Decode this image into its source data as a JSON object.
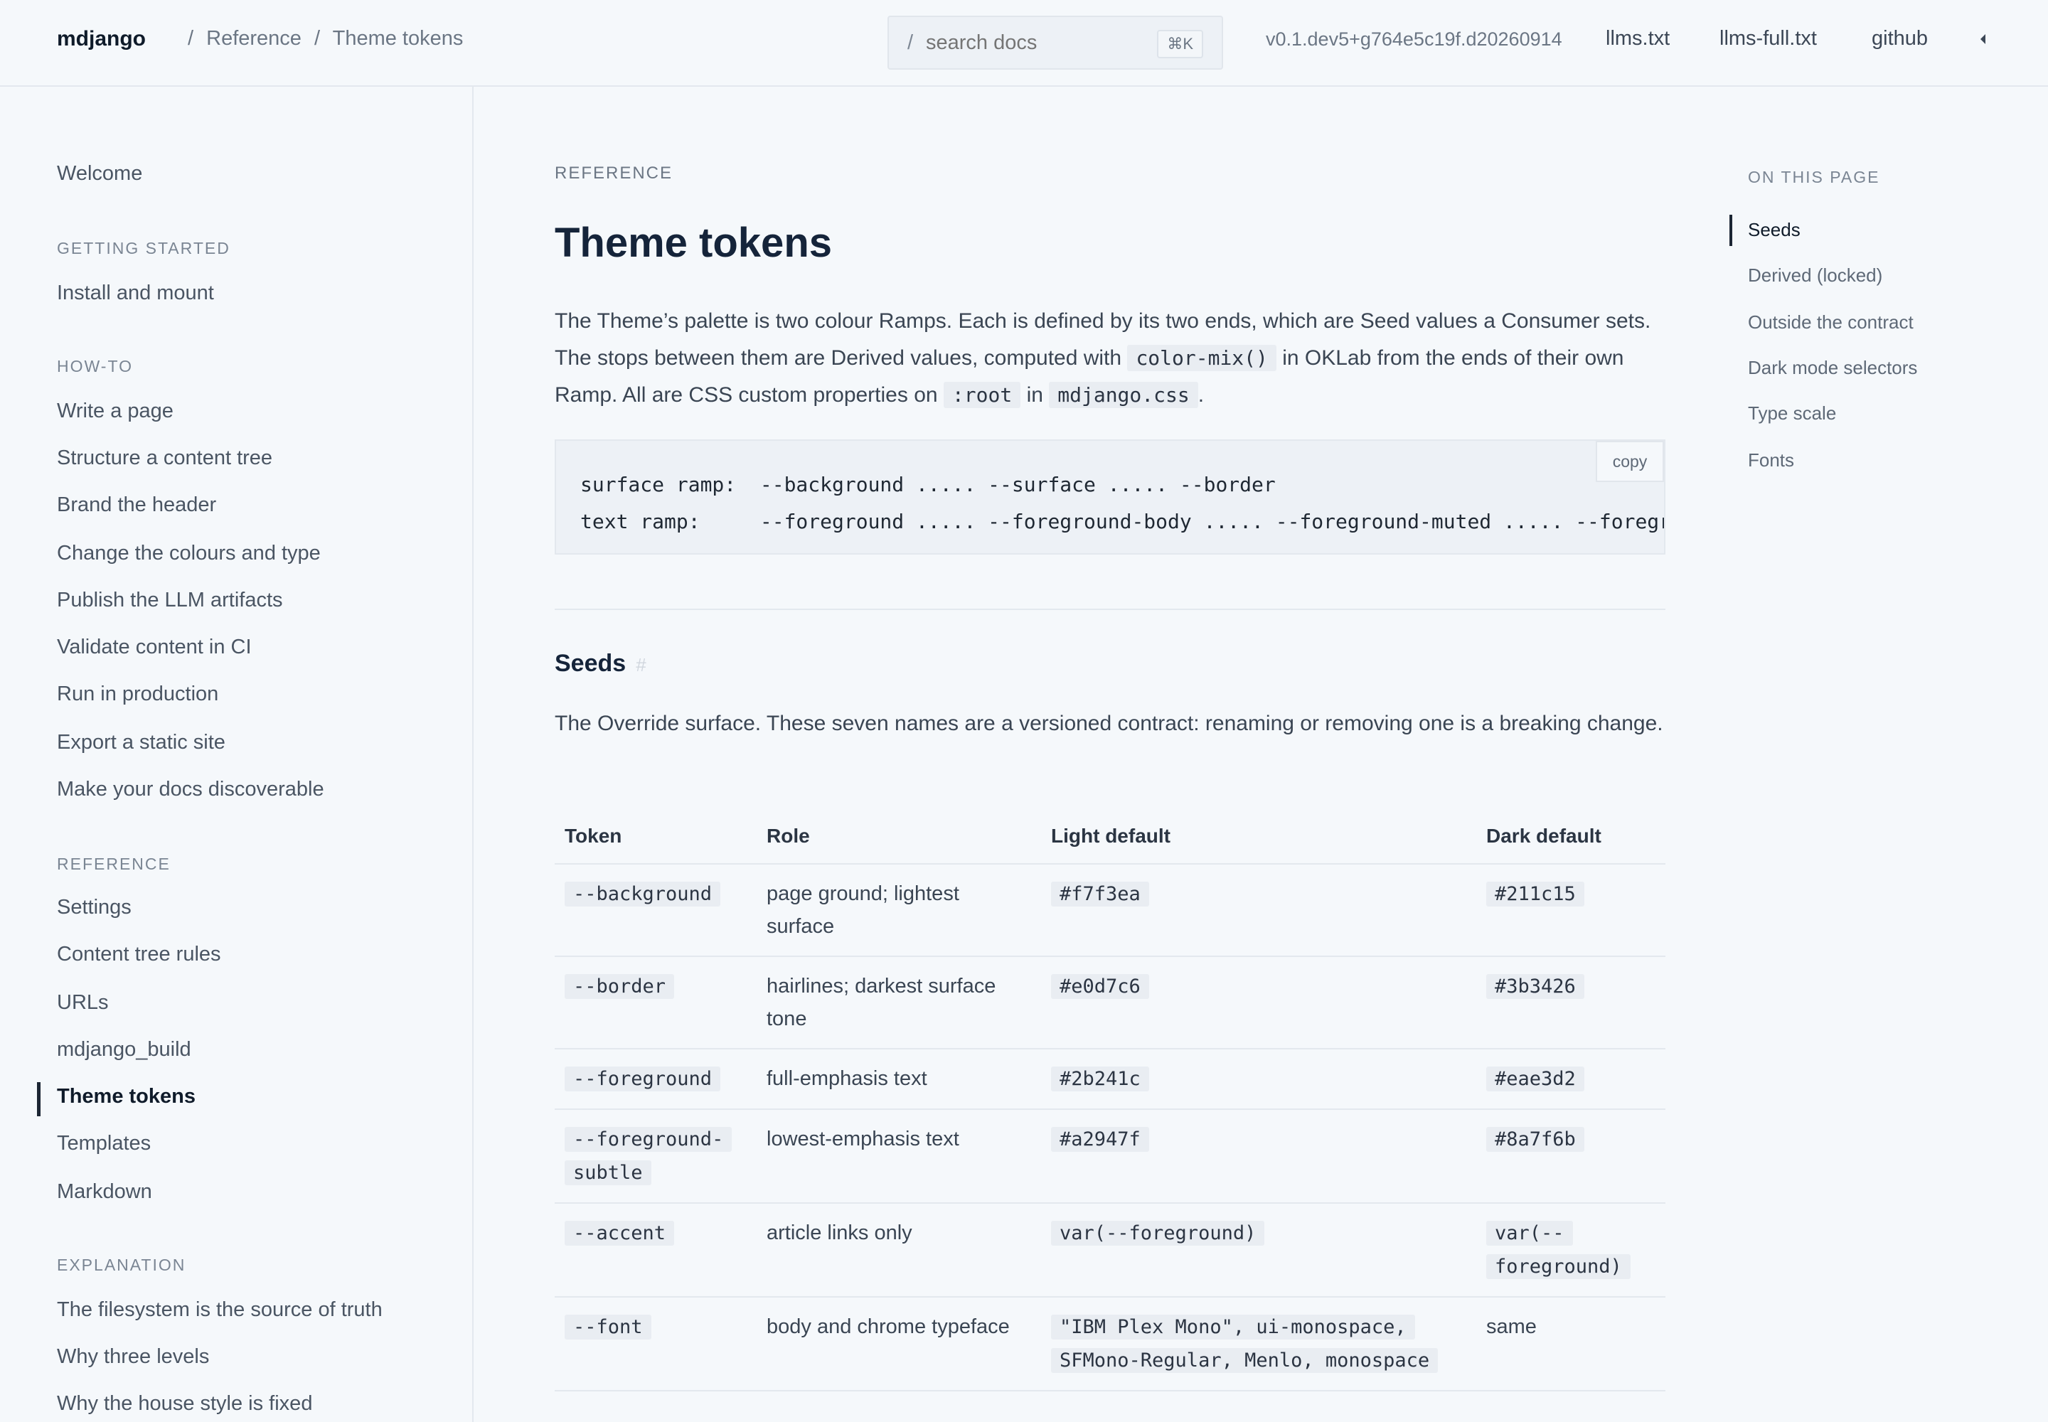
{
  "header": {
    "brand": "mdjango",
    "breadcrumb": [
      "/",
      "Reference",
      "/",
      "Theme tokens"
    ],
    "search": {
      "prefix": "/",
      "placeholder": "search docs",
      "shortcut": "⌘K"
    },
    "version": "v0.1.dev5+g764e5c19f.d20260914",
    "links": [
      "llms.txt",
      "llms-full.txt",
      "github"
    ]
  },
  "sidebar": {
    "welcome": "Welcome",
    "sections": [
      {
        "title": "GETTING STARTED",
        "items": [
          "Install and mount"
        ]
      },
      {
        "title": "HOW-TO",
        "items": [
          "Write a page",
          "Structure a content tree",
          "Brand the header",
          "Change the colours and type",
          "Publish the LLM artifacts",
          "Validate content in CI",
          "Run in production",
          "Export a static site",
          "Make your docs discoverable"
        ]
      },
      {
        "title": "REFERENCE",
        "items": [
          "Settings",
          "Content tree rules",
          "URLs",
          "mdjango_build",
          "Theme tokens",
          "Templates",
          "Markdown"
        ]
      },
      {
        "title": "EXPLANATION",
        "items": [
          "The filesystem is the source of truth",
          "Why three levels",
          "Why the house style is fixed"
        ]
      }
    ],
    "active": "Theme tokens"
  },
  "main": {
    "eyebrow": "REFERENCE",
    "title": "Theme tokens",
    "intro": {
      "t1": "The Theme’s palette is two colour Ramps. Each is defined by its two ends, which are Seed values a Consumer sets. The stops between them are Derived values, computed with",
      "c1": "color-mix()",
      "t2": "in OKLab from the ends of their own Ramp. All are CSS custom properties on",
      "c2": ":root",
      "t3": "in",
      "c3": "mdjango.css",
      "t4": "."
    },
    "code": {
      "line1": "surface ramp:  --background ..... --surface ..... --border",
      "line2": "text ramp:     --foreground ..... --foreground-body ..... --foreground-muted ..... --foreground-subtle",
      "copy": "copy"
    },
    "seeds": {
      "heading": "Seeds",
      "anchor": "#",
      "text": "The Override surface. These seven names are a versioned contract: renaming or removing one is a breaking change.",
      "columns": [
        "Token",
        "Role",
        "Light default",
        "Dark default"
      ],
      "rows": [
        {
          "token": "--background",
          "role": "page ground; lightest surface",
          "light": "#f7f3ea",
          "dark": "#211c15"
        },
        {
          "token": "--border",
          "role": "hairlines; darkest surface tone",
          "light": "#e0d7c6",
          "dark": "#3b3426"
        },
        {
          "token": "--foreground",
          "role": "full-emphasis text",
          "light": "#2b241c",
          "dark": "#eae3d2"
        },
        {
          "token": "--foreground-subtle",
          "role": "lowest-emphasis text",
          "light": "#a2947f",
          "dark": "#8a7f6b"
        },
        {
          "token": "--accent",
          "role": "article links only",
          "light": "var(--foreground)",
          "dark": "var(--foreground)"
        },
        {
          "token": "--font",
          "role": "body and chrome typeface",
          "light": "\"IBM Plex Mono\", ui-monospace, SFMono-Regular, Menlo, monospace",
          "dark": "same"
        }
      ]
    }
  },
  "toc": {
    "title": "ON THIS PAGE",
    "items": [
      "Seeds",
      "Derived (locked)",
      "Outside the contract",
      "Dark mode selectors",
      "Type scale",
      "Fonts"
    ]
  }
}
